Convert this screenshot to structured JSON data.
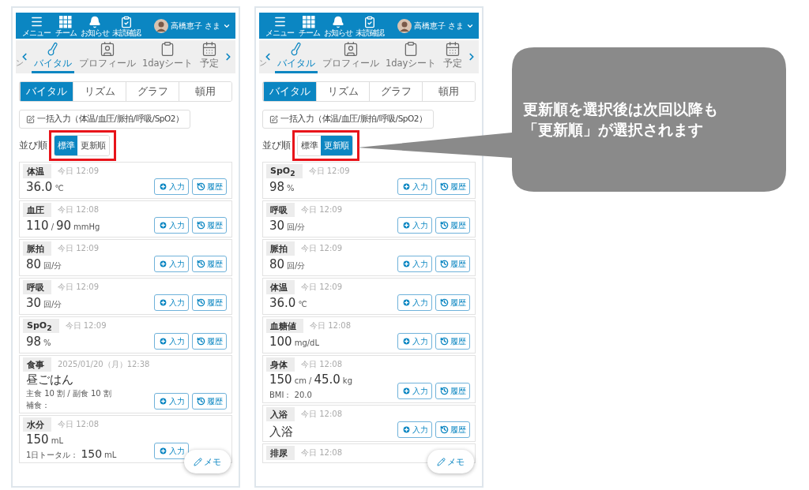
{
  "phones": [
    {
      "header": {
        "items": [
          {
            "label": "メニュー",
            "kind": "menu"
          },
          {
            "label": "チーム",
            "kind": "team"
          },
          {
            "label": "お知らせ",
            "kind": "notice"
          },
          {
            "label": "未読確認",
            "kind": "unread"
          }
        ],
        "user": "高橋恵子 さま"
      },
      "nav": {
        "fragment": "ン",
        "items": [
          {
            "label": "バイタル",
            "kind": "vital",
            "selected": true
          },
          {
            "label": "プロフィール",
            "kind": "profile",
            "selected": false
          },
          {
            "label": "1dayシート",
            "kind": "sheet",
            "selected": false
          },
          {
            "label": "予定",
            "kind": "schedule",
            "selected": false
          }
        ]
      },
      "tabs": [
        {
          "label": "バイタル",
          "selected": true
        },
        {
          "label": "リズム",
          "selected": false
        },
        {
          "label": "グラフ",
          "selected": false
        },
        {
          "label": "頓用",
          "selected": false
        }
      ],
      "bulk_button": "一括入力（体温/血圧/脈拍/呼吸/SpO2）",
      "sort": {
        "label": "並び順",
        "options": [
          {
            "label": "標準",
            "selected": true
          },
          {
            "label": "更新順",
            "selected": false
          }
        ]
      },
      "cards": [
        {
          "title": "体温",
          "time": "今日 12:09",
          "value": [
            {
              "text": "36.0",
              "kind": "number"
            },
            {
              "text": "℃",
              "kind": "unit"
            }
          ],
          "buttons": [
            {
              "kind": "input",
              "label": "入力"
            },
            {
              "kind": "history",
              "label": "履歴"
            }
          ]
        },
        {
          "title": "血圧",
          "time": "今日 12:08",
          "value": [
            {
              "text": "110",
              "kind": "number"
            },
            {
              "text": "/",
              "kind": "unit"
            },
            {
              "text": "90",
              "kind": "number"
            },
            {
              "text": "mmHg",
              "kind": "unit"
            }
          ],
          "buttons": [
            {
              "kind": "input",
              "label": "入力"
            },
            {
              "kind": "history",
              "label": "履歴"
            }
          ]
        },
        {
          "title": "脈拍",
          "time": "今日 12:09",
          "value": [
            {
              "text": "80",
              "kind": "number"
            },
            {
              "text": "回/分",
              "kind": "unit"
            }
          ],
          "buttons": [
            {
              "kind": "input",
              "label": "入力"
            },
            {
              "kind": "history",
              "label": "履歴"
            }
          ]
        },
        {
          "title": "呼吸",
          "time": "今日 12:09",
          "value": [
            {
              "text": "30",
              "kind": "number"
            },
            {
              "text": "回/分",
              "kind": "unit"
            }
          ],
          "buttons": [
            {
              "kind": "input",
              "label": "入力"
            },
            {
              "kind": "history",
              "label": "履歴"
            }
          ]
        },
        {
          "title": "SpO$_{2}$",
          "time": "今日 12:09",
          "value": [
            {
              "text": "98",
              "kind": "number"
            },
            {
              "text": "%",
              "kind": "unit"
            }
          ],
          "buttons": [
            {
              "kind": "input",
              "label": "入力"
            },
            {
              "kind": "history",
              "label": "履歴"
            }
          ]
        },
        {
          "title": "食事",
          "time": "2025/01/20（月）12:38",
          "value": [
            {
              "text": "昼ごはん",
              "kind": "number"
            }
          ],
          "details": [
            [
              {
                "text": "主食 10 割 / 副食 10 割",
                "kind": "unit"
              }
            ],
            [
              {
                "text": "補食：",
                "kind": "unit"
              }
            ]
          ],
          "buttons": [
            {
              "kind": "input",
              "label": "入力"
            },
            {
              "kind": "history",
              "label": "履歴"
            }
          ]
        },
        {
          "title": "水分",
          "time": "今日 12:08",
          "value": [
            {
              "text": "150",
              "kind": "number"
            },
            {
              "text": "mL",
              "kind": "unit"
            }
          ],
          "details": [
            [
              {
                "text": "1日トータル：",
                "kind": "unit"
              },
              {
                "text": "150",
                "kind": "number"
              },
              {
                "text": "mL",
                "kind": "unit"
              }
            ]
          ],
          "buttons": [
            {
              "kind": "input",
              "label": "入力"
            }
          ]
        }
      ],
      "memo_button": "メモ"
    },
    {
      "header": {
        "items": [
          {
            "label": "メニュー",
            "kind": "menu"
          },
          {
            "label": "チーム",
            "kind": "team"
          },
          {
            "label": "お知らせ",
            "kind": "notice"
          },
          {
            "label": "未読確認",
            "kind": "unread"
          }
        ],
        "user": "高橋恵子 さま"
      },
      "nav": {
        "fragment": "ン",
        "items": [
          {
            "label": "バイタル",
            "kind": "vital",
            "selected": true
          },
          {
            "label": "プロフィール",
            "kind": "profile",
            "selected": false
          },
          {
            "label": "1dayシート",
            "kind": "sheet",
            "selected": false
          },
          {
            "label": "予定",
            "kind": "schedule",
            "selected": false
          }
        ]
      },
      "tabs": [
        {
          "label": "バイタル",
          "selected": true
        },
        {
          "label": "リズム",
          "selected": false
        },
        {
          "label": "グラフ",
          "selected": false
        },
        {
          "label": "頓用",
          "selected": false
        }
      ],
      "bulk_button": "一括入力（体温/血圧/脈拍/呼吸/SpO2）",
      "sort": {
        "label": "並び順",
        "options": [
          {
            "label": "標準",
            "selected": false
          },
          {
            "label": "更新順",
            "selected": true
          }
        ]
      },
      "cards": [
        {
          "title": "SpO$_{2}$",
          "time": "今日 12:09",
          "value": [
            {
              "text": "98",
              "kind": "number"
            },
            {
              "text": "%",
              "kind": "unit"
            }
          ],
          "buttons": [
            {
              "kind": "input",
              "label": "入力"
            },
            {
              "kind": "history",
              "label": "履歴"
            }
          ]
        },
        {
          "title": "呼吸",
          "time": "今日 12:09",
          "value": [
            {
              "text": "30",
              "kind": "number"
            },
            {
              "text": "回/分",
              "kind": "unit"
            }
          ],
          "buttons": [
            {
              "kind": "input",
              "label": "入力"
            },
            {
              "kind": "history",
              "label": "履歴"
            }
          ]
        },
        {
          "title": "脈拍",
          "time": "今日 12:09",
          "value": [
            {
              "text": "80",
              "kind": "number"
            },
            {
              "text": "回/分",
              "kind": "unit"
            }
          ],
          "buttons": [
            {
              "kind": "input",
              "label": "入力"
            },
            {
              "kind": "history",
              "label": "履歴"
            }
          ]
        },
        {
          "title": "体温",
          "time": "今日 12:09",
          "value": [
            {
              "text": "36.0",
              "kind": "number"
            },
            {
              "text": "℃",
              "kind": "unit"
            }
          ],
          "buttons": [
            {
              "kind": "input",
              "label": "入力"
            },
            {
              "kind": "history",
              "label": "履歴"
            }
          ]
        },
        {
          "title": "血糖値",
          "time": "今日 12:08",
          "value": [
            {
              "text": "100",
              "kind": "number"
            },
            {
              "text": "mg/dL",
              "kind": "unit"
            }
          ],
          "buttons": [
            {
              "kind": "input",
              "label": "入力"
            },
            {
              "kind": "history",
              "label": "履歴"
            }
          ]
        },
        {
          "title": "身体",
          "time": "今日 12:08",
          "value": [
            {
              "text": "150",
              "kind": "number"
            },
            {
              "text": "cm /",
              "kind": "unit"
            },
            {
              "text": "45.0",
              "kind": "number"
            },
            {
              "text": "kg",
              "kind": "unit"
            }
          ],
          "details": [
            [
              {
                "text": "BMI： 20.0",
                "kind": "unit"
              }
            ]
          ],
          "buttons": [
            {
              "kind": "input",
              "label": "入力"
            },
            {
              "kind": "history",
              "label": "履歴"
            }
          ]
        },
        {
          "title": "入浴",
          "time": "今日 12:08",
          "value": [
            {
              "text": "入浴",
              "kind": "number"
            }
          ],
          "buttons": [
            {
              "kind": "input",
              "label": "入力"
            },
            {
              "kind": "history",
              "label": "履歴"
            }
          ]
        },
        {
          "title": "排尿",
          "time": "今日 12:08"
        }
      ],
      "memo_button": "メモ"
    }
  ],
  "callout": {
    "lines": [
      "更新順を選択後は次回以降も",
      "「更新順」が選択されます"
    ]
  }
}
